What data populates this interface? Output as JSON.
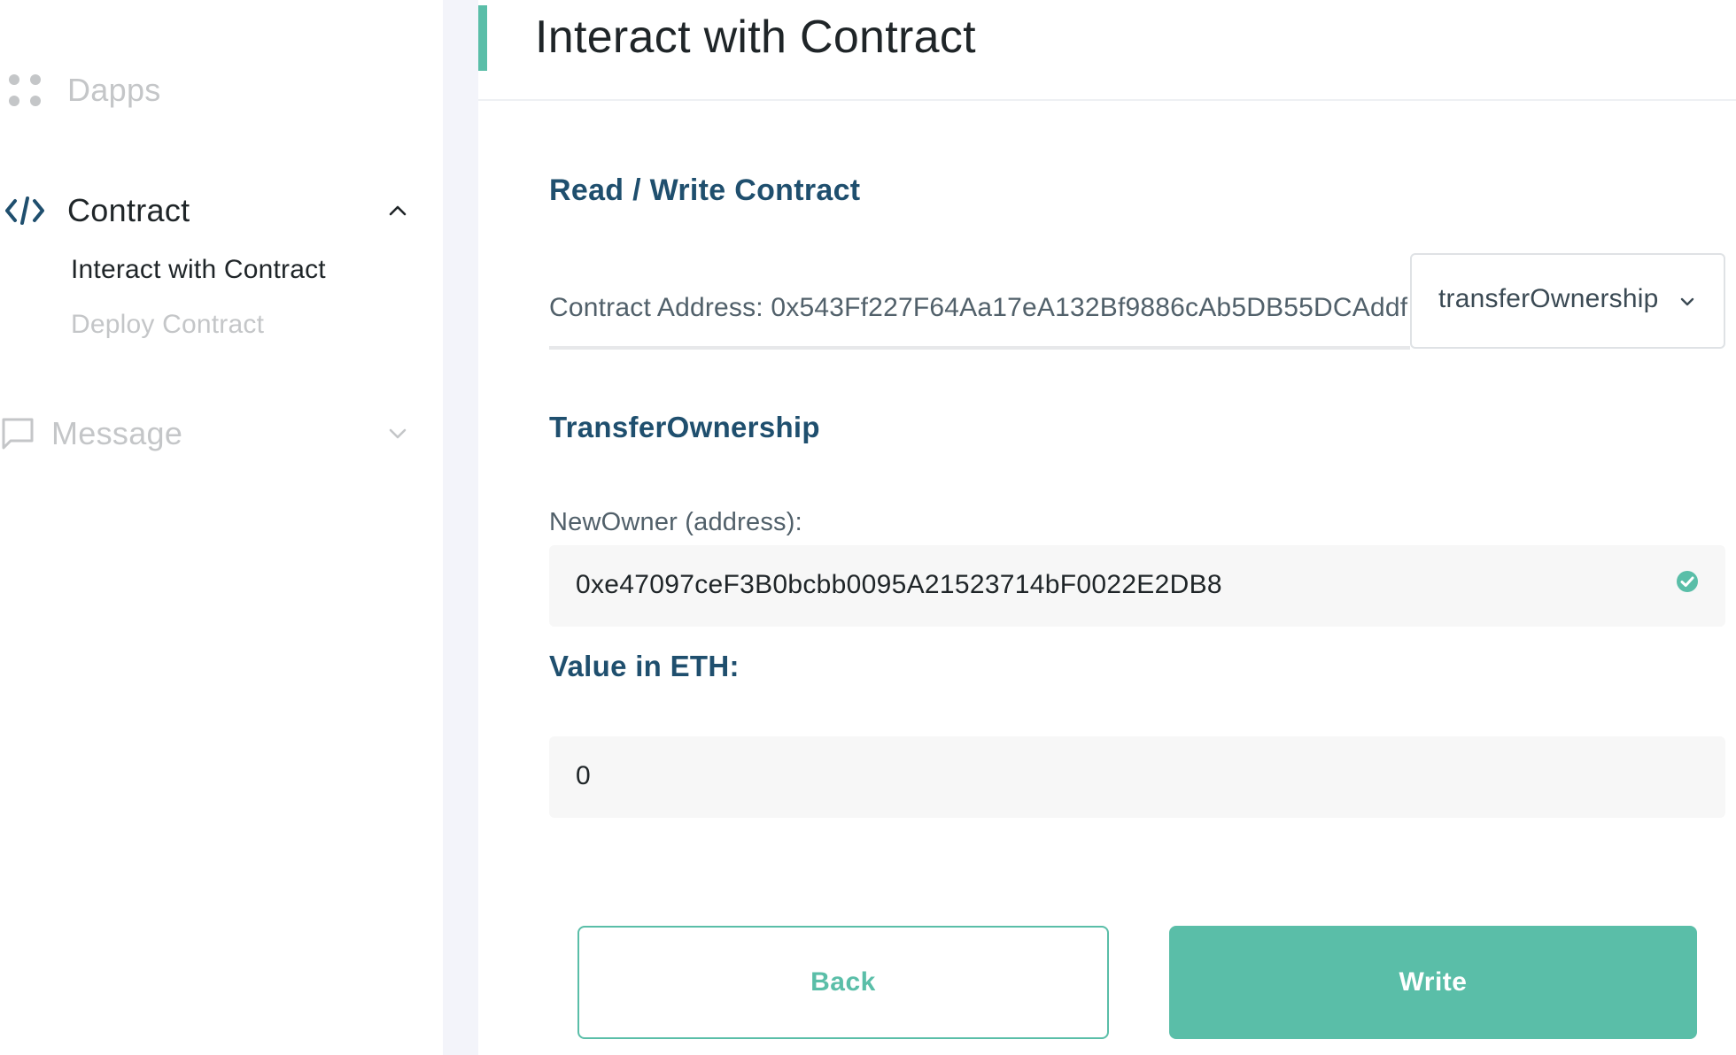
{
  "sidebar": {
    "items": [
      {
        "label": "Dapps",
        "icon": "grid-dots-icon",
        "state": "inactive"
      },
      {
        "label": "Contract",
        "icon": "code-icon",
        "state": "active-expanded"
      },
      {
        "label": "Message",
        "icon": "chat-bubble-icon",
        "state": "collapsed"
      }
    ],
    "contract_subitems": [
      {
        "label": "Interact with Contract",
        "state": "active"
      },
      {
        "label": "Deploy Contract",
        "state": "inactive"
      }
    ]
  },
  "header": {
    "title": "Interact with Contract"
  },
  "main": {
    "section_title": "Read / Write Contract",
    "contract_address_text": "Contract Address: 0x543Ff227F64Aa17eA132Bf9886cAb5DB55DCAddf",
    "function_select": {
      "selected": "transferOwnership"
    },
    "function_title": "TransferOwnership",
    "new_owner": {
      "label": "NewOwner (address):",
      "value": "0xe47097ceF3B0bcbb0095A21523714bF0022E2DB8"
    },
    "value_eth": {
      "label": "Value in ETH:",
      "value": "0"
    },
    "buttons": {
      "back_label": "Back",
      "write_label": "Write"
    }
  },
  "colors": {
    "accent": "#5abea8",
    "heading_blue": "#1f4f6e",
    "muted_gray": "#c4c6c8",
    "text_dark": "#1f2528"
  }
}
